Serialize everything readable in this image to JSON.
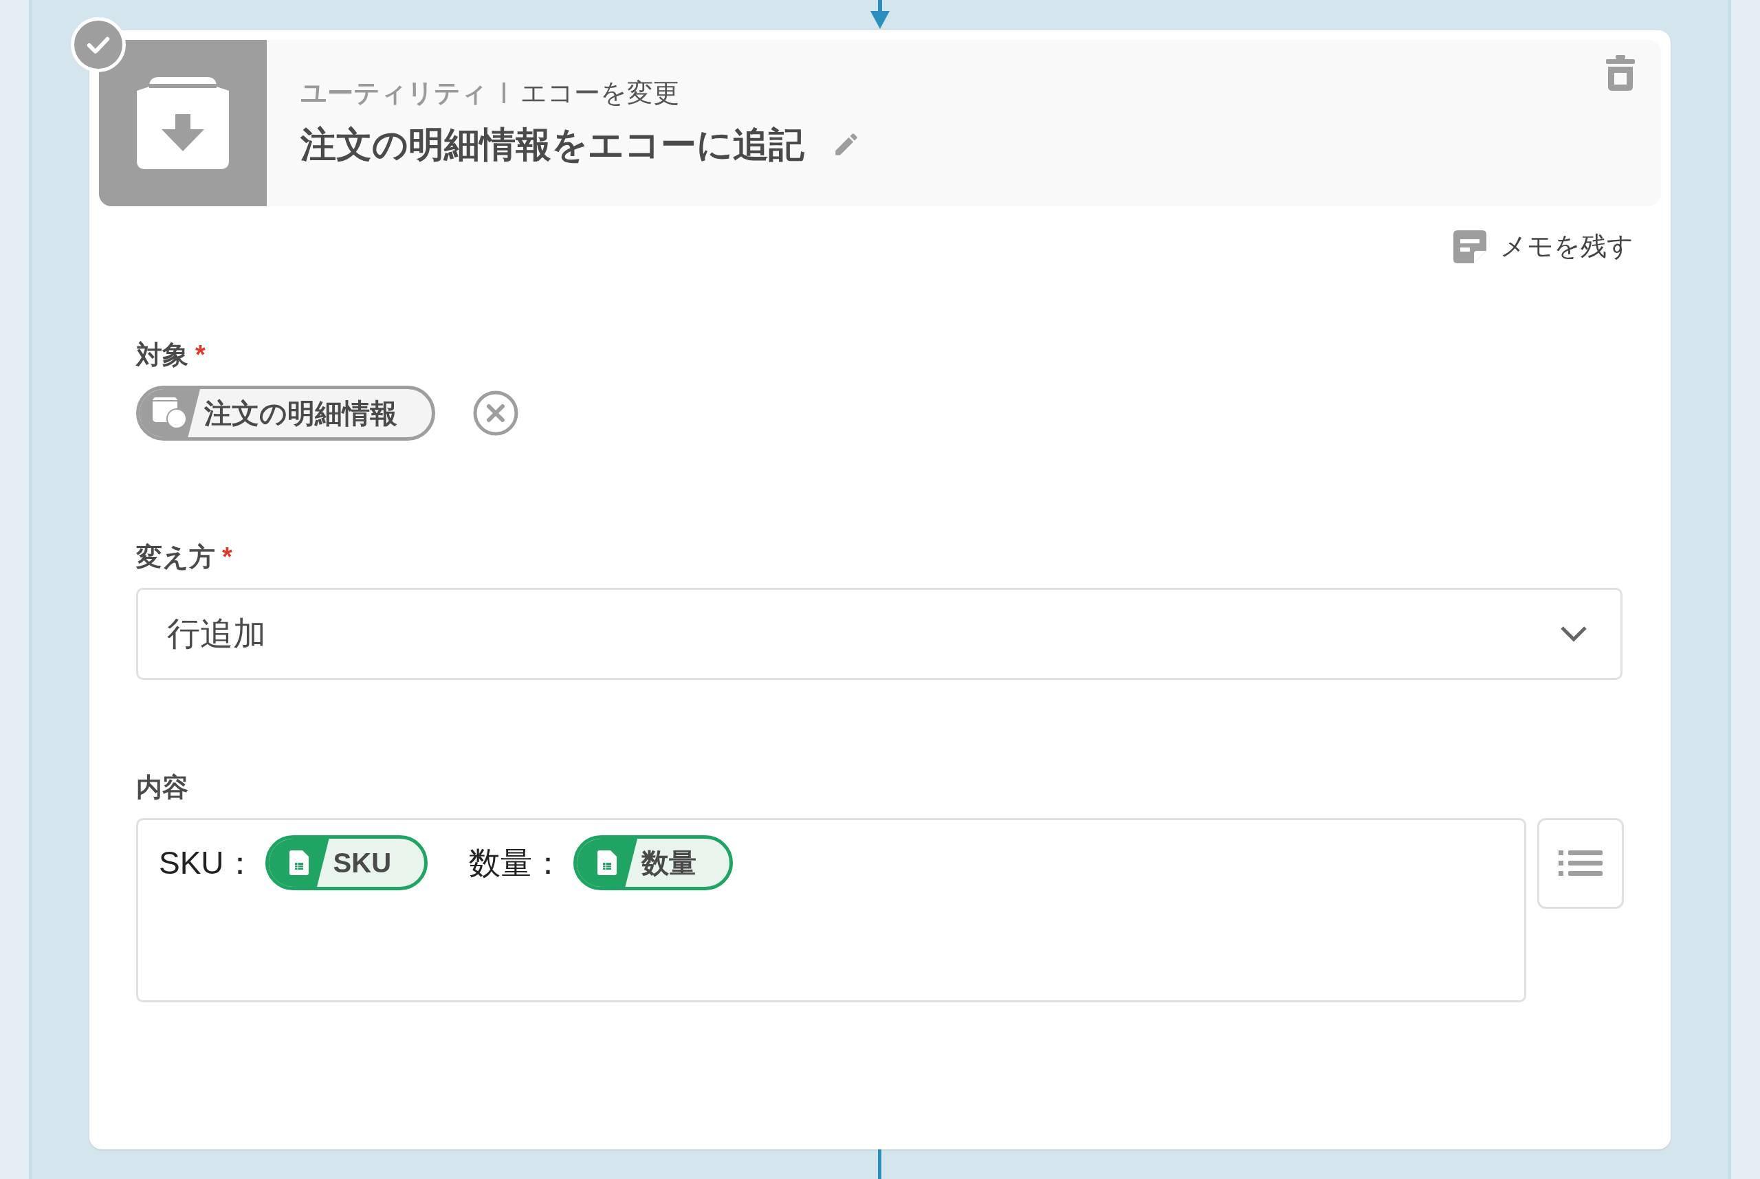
{
  "step": {
    "completed": true,
    "category": "ユーティリティ",
    "action": "エコーを変更",
    "title": "注文の明細情報をエコーに追記"
  },
  "memo_link": "メモを残す",
  "fields": [
    {
      "kind": "chip",
      "label": "対象",
      "required_mark": "*",
      "chip": "注文の明細情報"
    },
    {
      "kind": "select",
      "label": "変え方",
      "required_mark": "*",
      "value": "行追加"
    },
    {
      "kind": "rich_text",
      "label": "内容",
      "segments": [
        {
          "kind": "text",
          "text": "SKU："
        },
        {
          "kind": "token",
          "text": "SKU"
        },
        {
          "kind": "text",
          "text": "数量："
        },
        {
          "kind": "token",
          "text": "数量"
        }
      ]
    }
  ]
}
